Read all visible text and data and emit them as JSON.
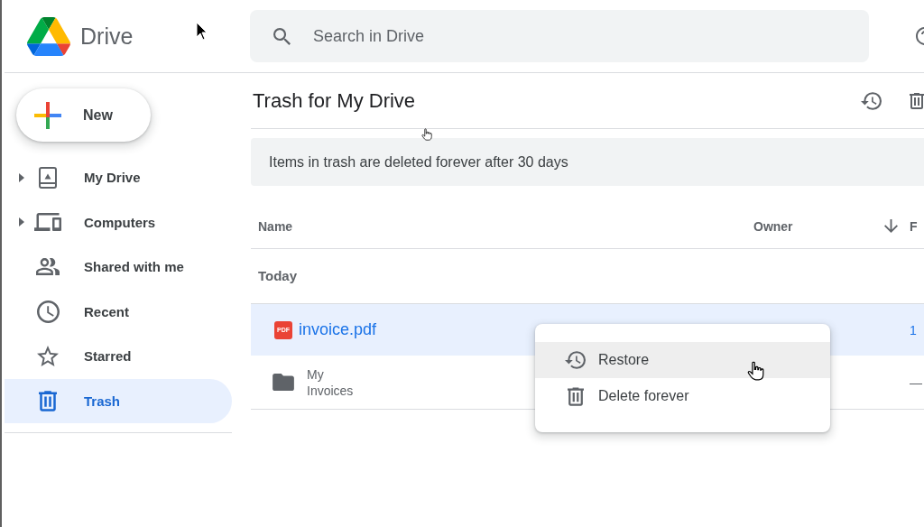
{
  "header": {
    "app_name": "Drive",
    "search": {
      "placeholder": "Search in Drive"
    }
  },
  "sidebar": {
    "new_button": "New",
    "items": [
      {
        "label": "My Drive",
        "expandable": true,
        "selected": false
      },
      {
        "label": "Computers",
        "expandable": true,
        "selected": false
      },
      {
        "label": "Shared with me",
        "expandable": false,
        "selected": false
      },
      {
        "label": "Recent",
        "expandable": false,
        "selected": false
      },
      {
        "label": "Starred",
        "expandable": false,
        "selected": false
      },
      {
        "label": "Trash",
        "expandable": false,
        "selected": true
      }
    ]
  },
  "main": {
    "title": "Trash for My Drive",
    "notice": "Items in trash are deleted forever after 30 days",
    "table": {
      "columns": [
        {
          "label": "Name",
          "sorted": false
        },
        {
          "label": "Owner",
          "sorted": false
        },
        {
          "label": "F",
          "sorted": true
        }
      ],
      "sections": [
        {
          "label": "Today",
          "rows": [
            {
              "kind": "pdf",
              "icon_label": "PDF",
              "name": "invoice.pdf",
              "column_3": "1",
              "selected": true
            },
            {
              "kind": "folder",
              "name": "My Invoices",
              "column_3": "—",
              "selected": false
            }
          ]
        }
      ]
    }
  },
  "context_menu": {
    "items": [
      {
        "label": "Restore",
        "selected": true
      },
      {
        "label": "Delete forever",
        "selected": false
      }
    ]
  }
}
